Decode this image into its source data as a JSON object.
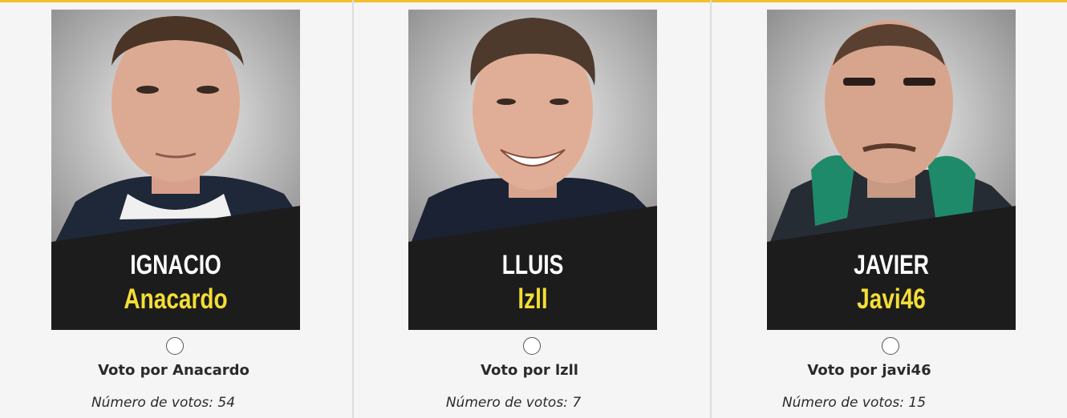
{
  "colors": {
    "accent": "#f2c02e",
    "nickname": "#f4de36",
    "card_bg": "#1c1c1c"
  },
  "candidates": [
    {
      "name": "IGNACIO",
      "nickname": "Anacardo",
      "vote_label": "Voto por Anacardo",
      "votes_text": "Número de votos: 54",
      "votes": 54,
      "selected": false
    },
    {
      "name": "LLUIS",
      "nickname": "lzll",
      "vote_label": "Voto por lzll",
      "votes_text": "Número de votos: 7",
      "votes": 7,
      "selected": false
    },
    {
      "name": "JAVIER",
      "nickname": "Javi46",
      "vote_label": "Voto por javi46",
      "votes_text": "Número de votos: 15",
      "votes": 15,
      "selected": false
    }
  ]
}
